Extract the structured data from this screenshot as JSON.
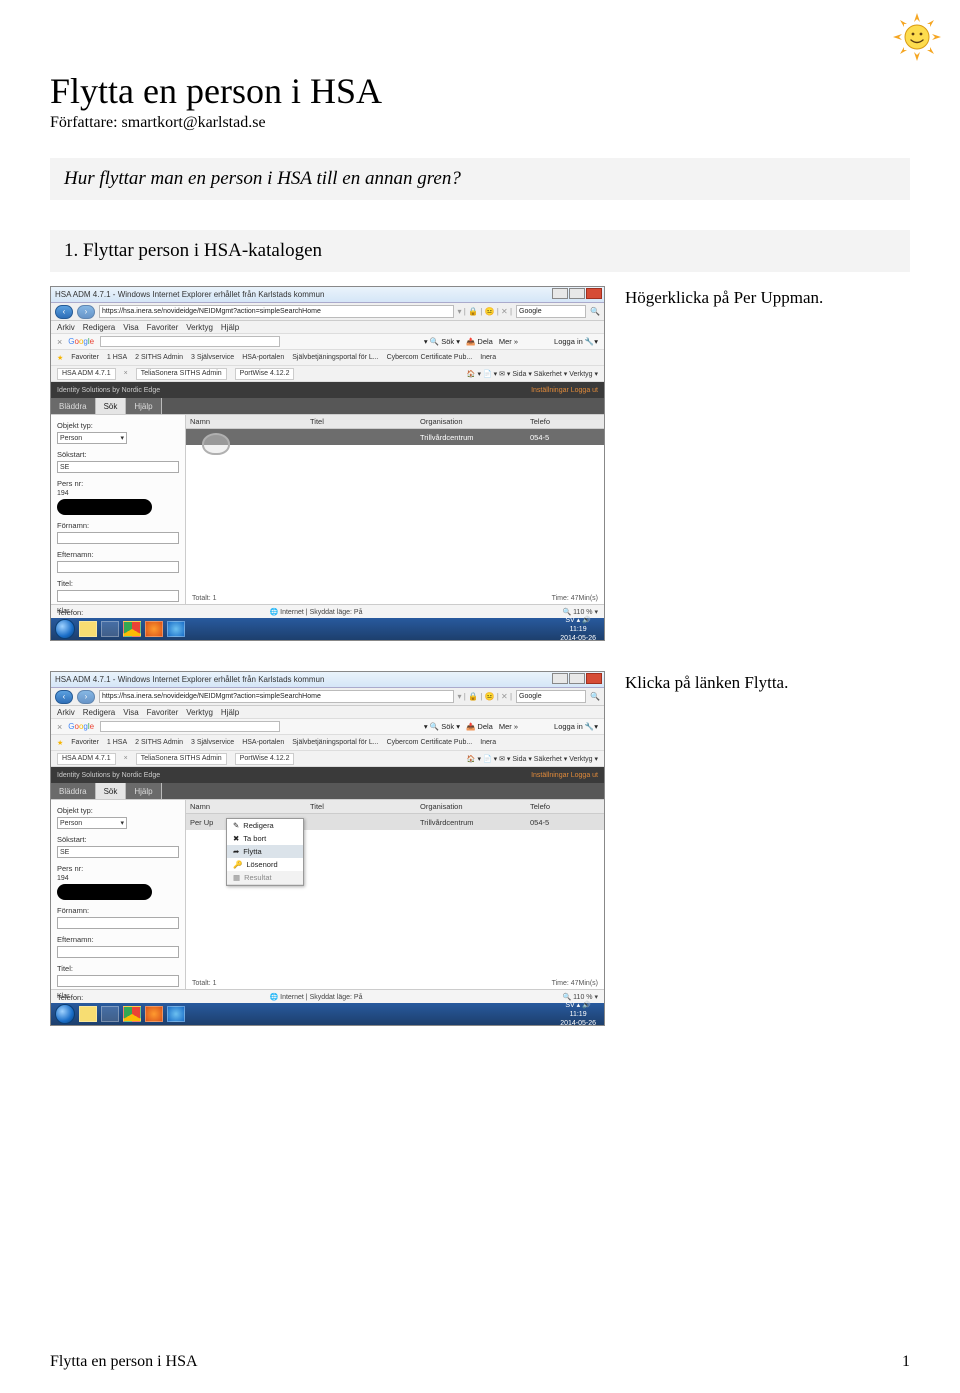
{
  "document": {
    "title": "Flytta en person i HSA",
    "author_line": "Författare: smartkort@karlstad.se",
    "question": "Hur flyttar man en person i HSA till en annan gren?",
    "step_heading": "1. Flyttar person i HSA-katalogen",
    "caption1": "Högerklicka på Per Uppman.",
    "caption2": "Klicka på länken Flytta.",
    "footer_left": "Flytta en person i HSA",
    "footer_right": "1"
  },
  "screenshot": {
    "window_title": "HSA ADM 4.7.1 - Windows Internet Explorer erhållet från Karlstads kommun",
    "address": "https://hsa.inera.se/novideidge/NEIDMgmt?action=simpleSearchHome",
    "search_hint": "Google",
    "menu": [
      "Arkiv",
      "Redigera",
      "Visa",
      "Favoriter",
      "Verktyg",
      "Hjälp"
    ],
    "google_bar": {
      "label": "Google",
      "sok": "Sök",
      "dela": "Dela",
      "mer": "Mer »",
      "login": "Logga in"
    },
    "favorites": {
      "label": "Favoriter",
      "items": [
        "1 HSA",
        "2 SITHS Admin",
        "3 Självservice",
        "HSA-portalen",
        "Självbetjäningsportal för L...",
        "Cybercom Certificate Pub...",
        "Inera"
      ]
    },
    "tabs": {
      "items": [
        "HSA ADM 4.7.1",
        "TeliaSonera SITHS Admin",
        "PortWise 4.12.2"
      ],
      "right": "Sida ▾  Säkerhet ▾  Verktyg ▾"
    },
    "dark_bar": {
      "left": "Identity Solutions by Nordic Edge",
      "right": "Inställningar  Logga ut"
    },
    "app_tabs": [
      "Bläddra",
      "Sök",
      "Hjälp"
    ],
    "left_panel": {
      "objekt_typ": "Objekt typ:",
      "objekt_val": "Person",
      "sokstart": "Sökstart:",
      "sokstart_val": "SE",
      "pers_nr": "Pers nr:",
      "pers_nr_prefix": "194",
      "fornamn": "Förnamn:",
      "efternamn": "Efternamn:",
      "titel": "Titel:",
      "telefon": "Telefon:"
    },
    "results": {
      "columns": [
        "Namn",
        "Titel",
        "Organisation",
        "Telefo"
      ],
      "row": {
        "namn": "Per Uppman",
        "titel": "",
        "org": "Trillvårdcentrum",
        "tel": "054-5"
      },
      "row2_name": "Per Up",
      "totalt": "Totalt: 1"
    },
    "context_menu": {
      "items": [
        "Redigera",
        "Ta bort",
        "Flytta",
        "Lösenord",
        "Resultat"
      ]
    },
    "time_label": "Time: 47Min(s)",
    "status": {
      "klar": "Klar",
      "internet": "Internet | Skyddat läge: På",
      "zoom": "110 %"
    },
    "clock": {
      "time": "11:19",
      "date": "2014-05-26",
      "lang": "SV"
    }
  }
}
